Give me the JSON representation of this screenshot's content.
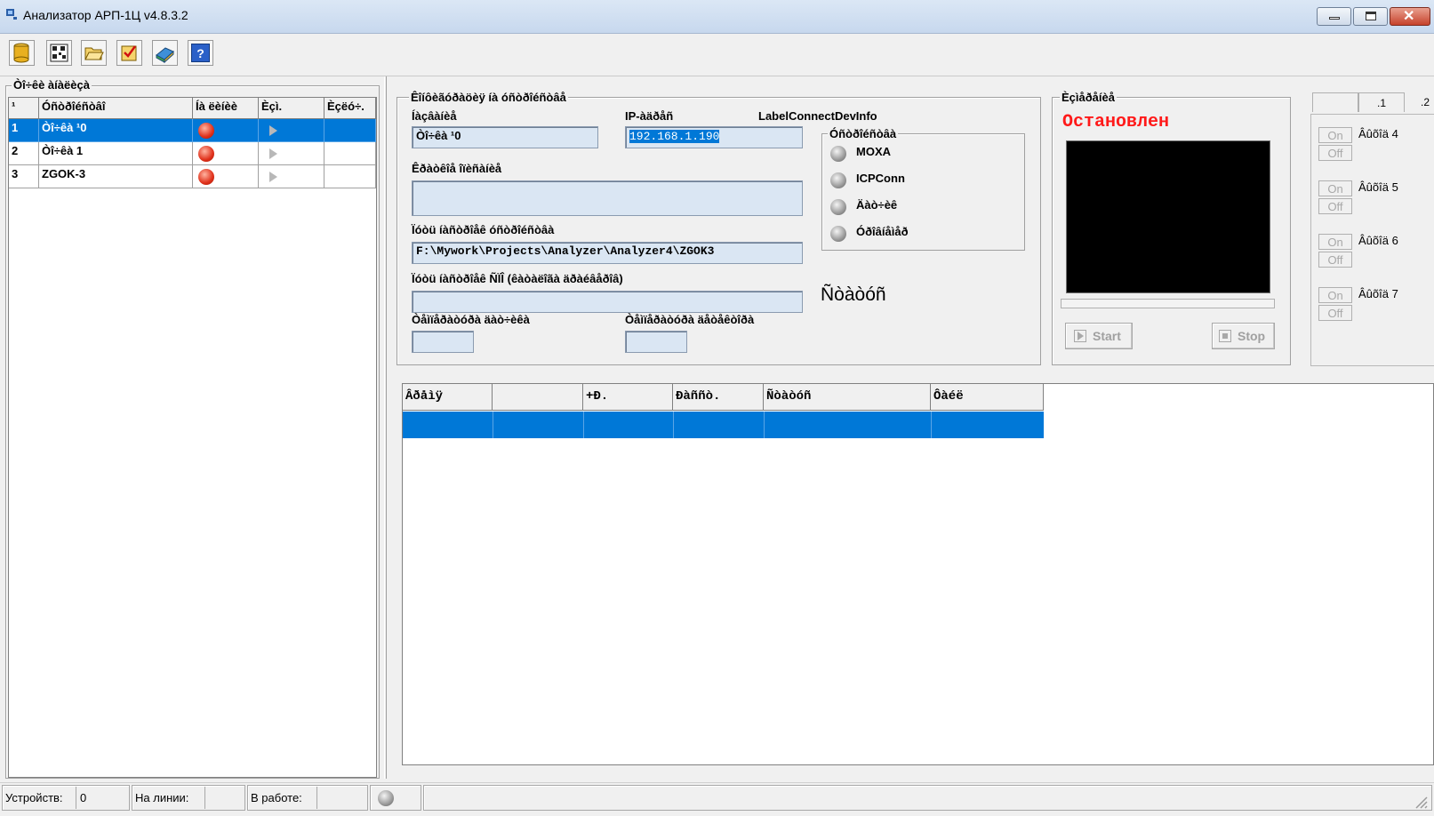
{
  "window": {
    "title": "Анализатор АРП-1Ц v4.8.3.2"
  },
  "toolbar": {
    "buttons": [
      {
        "icon": "database-icon"
      },
      {
        "icon": "qr-device-icon"
      },
      {
        "icon": "folder-open-icon"
      },
      {
        "icon": "checklist-icon"
      },
      {
        "icon": "book-icon"
      },
      {
        "icon": "help-icon"
      }
    ]
  },
  "points_panel": {
    "title": "Òî÷êè àíàëèçà",
    "columns": [
      "¹",
      "Óñòðîéñòâî",
      "Íà ëèíèè",
      "Èçì.",
      "Èçëó÷."
    ],
    "rows": [
      {
        "num": "1",
        "device": "Òî÷êà ¹0",
        "selected": true
      },
      {
        "num": "2",
        "device": "Òî÷êà 1",
        "selected": false
      },
      {
        "num": "3",
        "device": "ZGOK-3",
        "selected": false
      }
    ]
  },
  "config": {
    "title": "Êîíôèãóðàöèÿ íà óñòðîéñòâå",
    "name_label": "Íàçâàíèå",
    "name_value": "Òî÷êà ¹0",
    "ip_label": "IP-àäðåñ",
    "ip_value": "192.168.1.190",
    "connect_label": "LabelConnectDevInfo",
    "comment_label": "Êðàòêîå îïèñàíèå",
    "comment_value": "",
    "path_label": "Ïóòü íàñòðîåê óñòðîéñòâà",
    "path_value": "F:\\Mywork\\Projects\\Analyzer\\Analyzer4\\ZGOK3",
    "path2_label": "Ïóòü íàñòðîåê ÑÏÎ (êàòàëîãà äðàéâåðîâ)",
    "path2_value": "",
    "status_text": "Ñòàòóñ",
    "temp_sensor_label": "Òåìïåðàòóðà äàò÷èêà",
    "temp_sensor_value": "",
    "temp_detector_label": "Òåìïåðàòóðà äåòåêòîðà",
    "temp_detector_value": ""
  },
  "devices": {
    "title": "Óñòðîéñòâà",
    "items": [
      "MOXA",
      "ICPConn",
      "Äàò÷èê",
      "Óðîâíåìåð"
    ]
  },
  "measurement": {
    "title": "Èçìåðåíèå",
    "state": "Остановлен",
    "start_label": "Start",
    "stop_label": "Stop"
  },
  "tabs": [
    ".1",
    ".2"
  ],
  "outputs": [
    {
      "label": "Âûõîä 4",
      "on": "On",
      "off": "Off"
    },
    {
      "label": "Âûõîä 5",
      "on": "On",
      "off": "Off"
    },
    {
      "label": "Âûõîä 6",
      "on": "On",
      "off": "Off"
    },
    {
      "label": "Âûõîä 7",
      "on": "On",
      "off": "Off"
    }
  ],
  "log_table": {
    "columns": [
      "Âðåìÿ",
      "",
      "+Ð.",
      "Ðàññò.",
      "Ñòàòóñ",
      "Ôàéë"
    ]
  },
  "statusbar": {
    "devices_label": "Устройств:",
    "devices_value": "0",
    "online_label": "На линии:",
    "online_value": "",
    "working_label": "В работе:",
    "working_value": ""
  },
  "colors": {
    "selection": "#0078d7",
    "state_red": "#ff1a1a"
  }
}
